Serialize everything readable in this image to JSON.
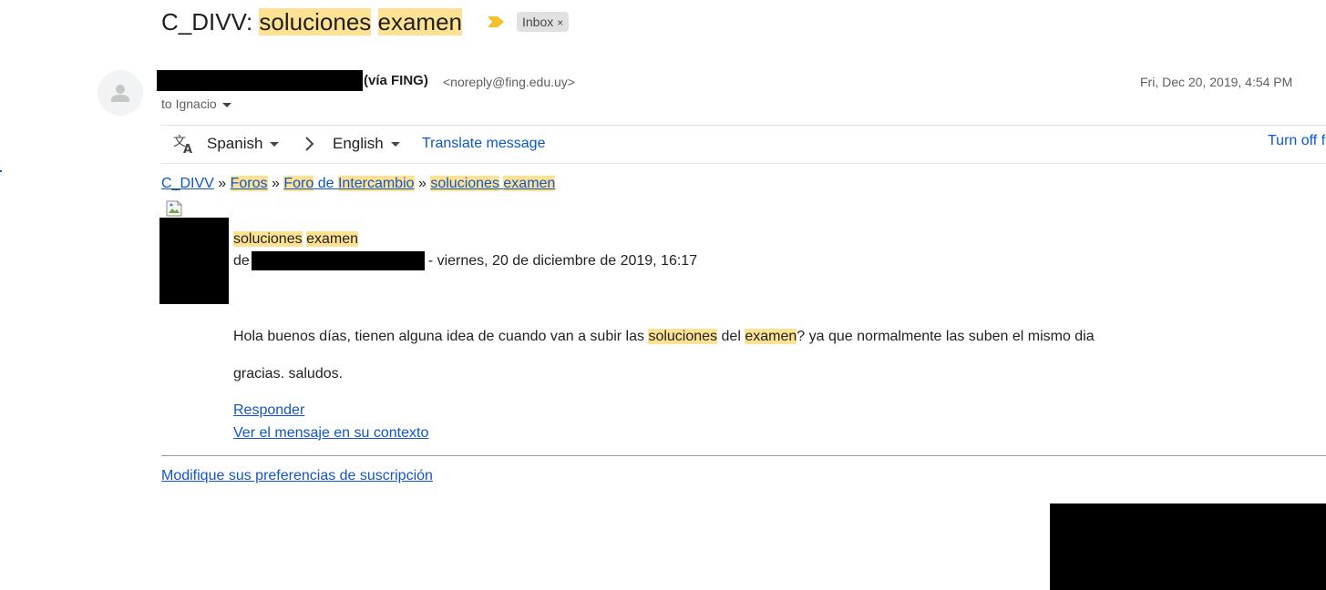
{
  "subject": {
    "prefix": "C_DIVV:",
    "word1": "soluciones",
    "word2": "examen"
  },
  "inbox_chip": {
    "label": "Inbox",
    "close": "×"
  },
  "sender": {
    "via": "(vía FING)",
    "email": "<noreply@fing.edu.uy>",
    "date": "Fri, Dec 20, 2019, 4:54 PM",
    "recipient": "to Ignacio"
  },
  "translate_bar": {
    "source_language": "Spanish",
    "target_language": "English",
    "translate_label": "Translate message",
    "turn_off_label": "Turn off f"
  },
  "breadcrumb": {
    "course": "C_DIVV",
    "separator": "»",
    "forums": "Foros",
    "forum_word1": "Foro",
    "forum_word2": "de",
    "forum_word3": "Intercambio",
    "topic_word1": "soluciones",
    "topic_word2": "examen"
  },
  "post": {
    "title_word1": "soluciones",
    "title_word2": "examen",
    "byline_prefix": "de",
    "byline_date": "- viernes, 20 de diciembre de 2019, 16:17",
    "text1_a": "Hola buenos días, tienen alguna idea de cuando van a subir las",
    "text1_hl1": "soluciones",
    "text1_b": "del",
    "text1_hl2": "examen",
    "text1_c": "? ya que normalmente las suben el mismo dia",
    "text2": "gracias. saludos.",
    "reply_label": "Responder",
    "context_label": "Ver el mensaje en su contexto"
  },
  "footer": {
    "preferences_label": "Modifique sus preferencias de suscripción"
  },
  "colors": {
    "highlight": "#fde293",
    "link": "#1155cc",
    "translate_link": "#0b57d0",
    "important_marker": "#f2c12e"
  },
  "icons": {
    "important": "important-marker-icon",
    "translate": "translate-icon",
    "arrow": "chevron-right-icon",
    "avatar": "default-avatar-icon",
    "broken_image": "broken-image-icon"
  }
}
